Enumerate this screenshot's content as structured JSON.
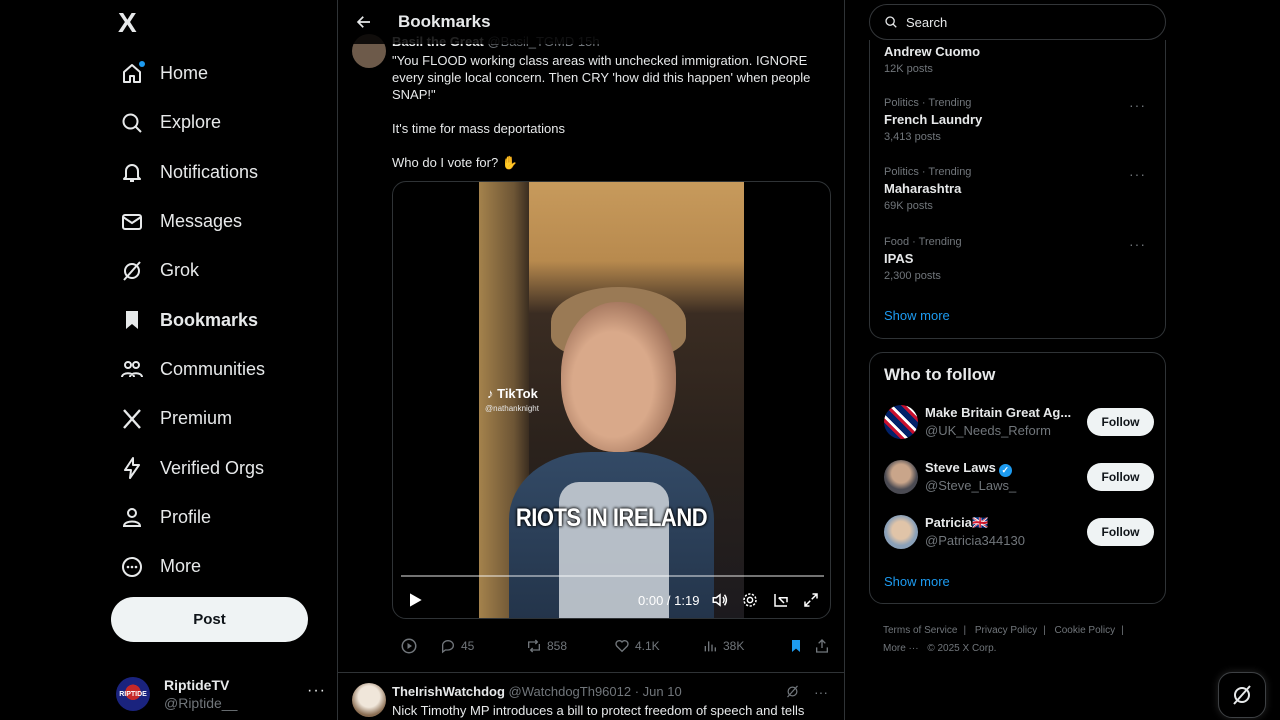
{
  "sidebar": {
    "logo": "X",
    "items": [
      {
        "label": "Home",
        "icon": "home-icon"
      },
      {
        "label": "Explore",
        "icon": "search-icon"
      },
      {
        "label": "Notifications",
        "icon": "bell-icon"
      },
      {
        "label": "Messages",
        "icon": "mail-icon"
      },
      {
        "label": "Grok",
        "icon": "grok-icon"
      },
      {
        "label": "Bookmarks",
        "icon": "bookmark-icon"
      },
      {
        "label": "Communities",
        "icon": "people-icon"
      },
      {
        "label": "Premium",
        "icon": "x-icon"
      },
      {
        "label": "Verified Orgs",
        "icon": "bolt-icon"
      },
      {
        "label": "Profile",
        "icon": "person-icon"
      },
      {
        "label": "More",
        "icon": "more-circle-icon"
      }
    ],
    "post_label": "Post",
    "account": {
      "name": "RiptideTV",
      "handle": "@Riptide__",
      "avatar_text": "RIPTIDE"
    }
  },
  "header": {
    "title": "Bookmarks"
  },
  "tweet1": {
    "name": "Basil the Great",
    "handle": "@Basil_TGMD",
    "time": "15h",
    "lines": [
      "\"You FLOOD working class areas with unchecked immigration. IGNORE every single local concern. Then CRY 'how did this happen' when people SNAP!\"",
      "It's time for mass deportations",
      "Who do I vote for? ✋"
    ],
    "video": {
      "watermark": "♪ TikTok",
      "watermark_user": "@nathanknight",
      "caption": "RIOTS IN IRELAND",
      "time": "0:00 / 1:19",
      "progress": 0
    },
    "stats": {
      "replies": "45",
      "reposts": "858",
      "likes": "4.1K",
      "views": "38K"
    }
  },
  "tweet2": {
    "name": "TheIrishWatchdog",
    "handle": "@WatchdogTh96012",
    "date": "· Jun 10",
    "text": "Nick Timothy MP introduces a bill to protect freedom of speech and tells"
  },
  "right": {
    "search_placeholder": "Search",
    "trends": [
      {
        "meta": "",
        "name": "Andrew Cuomo",
        "count": "12K posts"
      },
      {
        "meta": "Politics · Trending",
        "name": "French Laundry",
        "count": "3,413 posts"
      },
      {
        "meta": "Politics · Trending",
        "name": "Maharashtra",
        "count": "69K posts"
      },
      {
        "meta": "Food · Trending",
        "name": "IPAS",
        "count": "2,300 posts"
      }
    ],
    "show_more": "Show more",
    "who_to_follow": {
      "title": "Who to follow",
      "accounts": [
        {
          "name": "Make Britain Great Ag...",
          "handle": "@UK_Needs_Reform",
          "follow": "Follow"
        },
        {
          "name": "Steve Laws",
          "handle": "@Steve_Laws_",
          "follow": "Follow"
        },
        {
          "name": "Patricia🇬🇧",
          "handle": "@Patricia344130",
          "follow": "Follow"
        }
      ],
      "show_more": "Show more"
    },
    "footer": {
      "links": [
        "Terms of Service",
        "Privacy Policy",
        "Cookie Policy"
      ],
      "more": "More ···",
      "copyright": "© 2025 X Corp."
    }
  },
  "colors": {
    "accent": "#1d9bf0",
    "background": "#000000",
    "text": "#e7e9ea",
    "muted": "#71767b",
    "border": "#2f3336"
  }
}
